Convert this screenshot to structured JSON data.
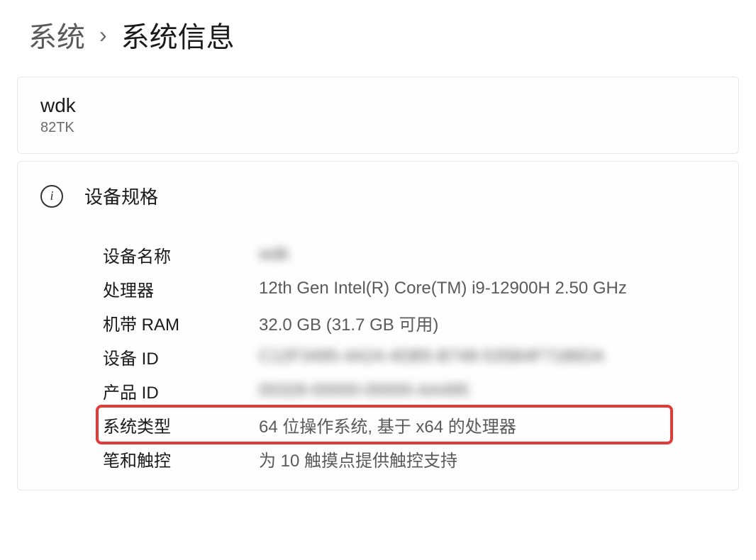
{
  "breadcrumb": {
    "parent": "系统",
    "separator": "›",
    "current": "系统信息"
  },
  "device": {
    "name": "wdk",
    "model": "82TK"
  },
  "specs": {
    "title": "设备规格",
    "rows": [
      {
        "label": "设备名称",
        "value": "wdk",
        "blurred": true
      },
      {
        "label": "处理器",
        "value": "12th Gen Intel(R) Core(TM) i9-12900H   2.50 GHz",
        "blurred": false
      },
      {
        "label": "机带 RAM",
        "value": "32.0 GB (31.7 GB 可用)",
        "blurred": false
      },
      {
        "label": "设备 ID",
        "value": "C12F3495-4A24-4DB5-B748-535B4F7186DA",
        "blurred": true
      },
      {
        "label": "产品 ID",
        "value": "00328-00000-00000-AA495",
        "blurred": true
      },
      {
        "label": "系统类型",
        "value": "64 位操作系统, 基于 x64 的处理器",
        "blurred": false,
        "highlighted": true
      },
      {
        "label": "笔和触控",
        "value": "为 10 触摸点提供触控支持",
        "blurred": false
      }
    ]
  }
}
